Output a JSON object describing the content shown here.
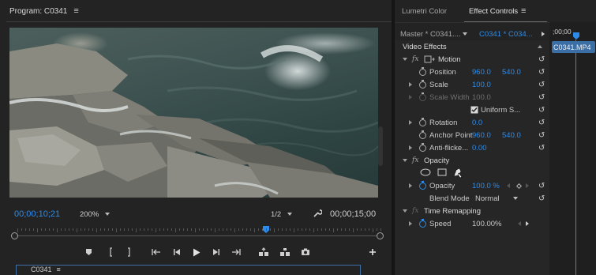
{
  "program": {
    "title": "Program: C0341",
    "timecode_current": "00;00;10;21",
    "zoom": "200%",
    "resolution": "1/2",
    "timecode_duration": "00;00;15;00",
    "sequence_tab": "C0341"
  },
  "effect_controls": {
    "tab_lumetri": "Lumetri Color",
    "tab_effect": "Effect Controls",
    "master_label": "Master * C0341....",
    "clip_label": "C0341 * C034...",
    "section_video": "Video Effects",
    "motion": "Motion",
    "position": {
      "label": "Position",
      "x": "960.0",
      "y": "540.0"
    },
    "scale": {
      "label": "Scale",
      "value": "100.0"
    },
    "scale_width": {
      "label": "Scale Width",
      "value": "100.0"
    },
    "uniform": "Uniform S...",
    "rotation": {
      "label": "Rotation",
      "value": "0.0"
    },
    "anchor": {
      "label": "Anchor Point",
      "x": "960.0",
      "y": "540.0"
    },
    "antiflicker": {
      "label": "Anti-flicke...",
      "value": "0.00"
    },
    "opacity_section": "Opacity",
    "opacity": {
      "label": "Opacity",
      "value": "100.0 %"
    },
    "blend": {
      "label": "Blend Mode",
      "value": "Normal"
    },
    "time_remap": "Time Remapping",
    "speed": {
      "label": "Speed",
      "value": "100.00%"
    },
    "timeline_time": ";00;00",
    "timeline_clip": "C0341.MP4"
  },
  "colors": {
    "accent": "#2d8ceb",
    "panel": "#232323",
    "clip": "#3a6ea5"
  }
}
